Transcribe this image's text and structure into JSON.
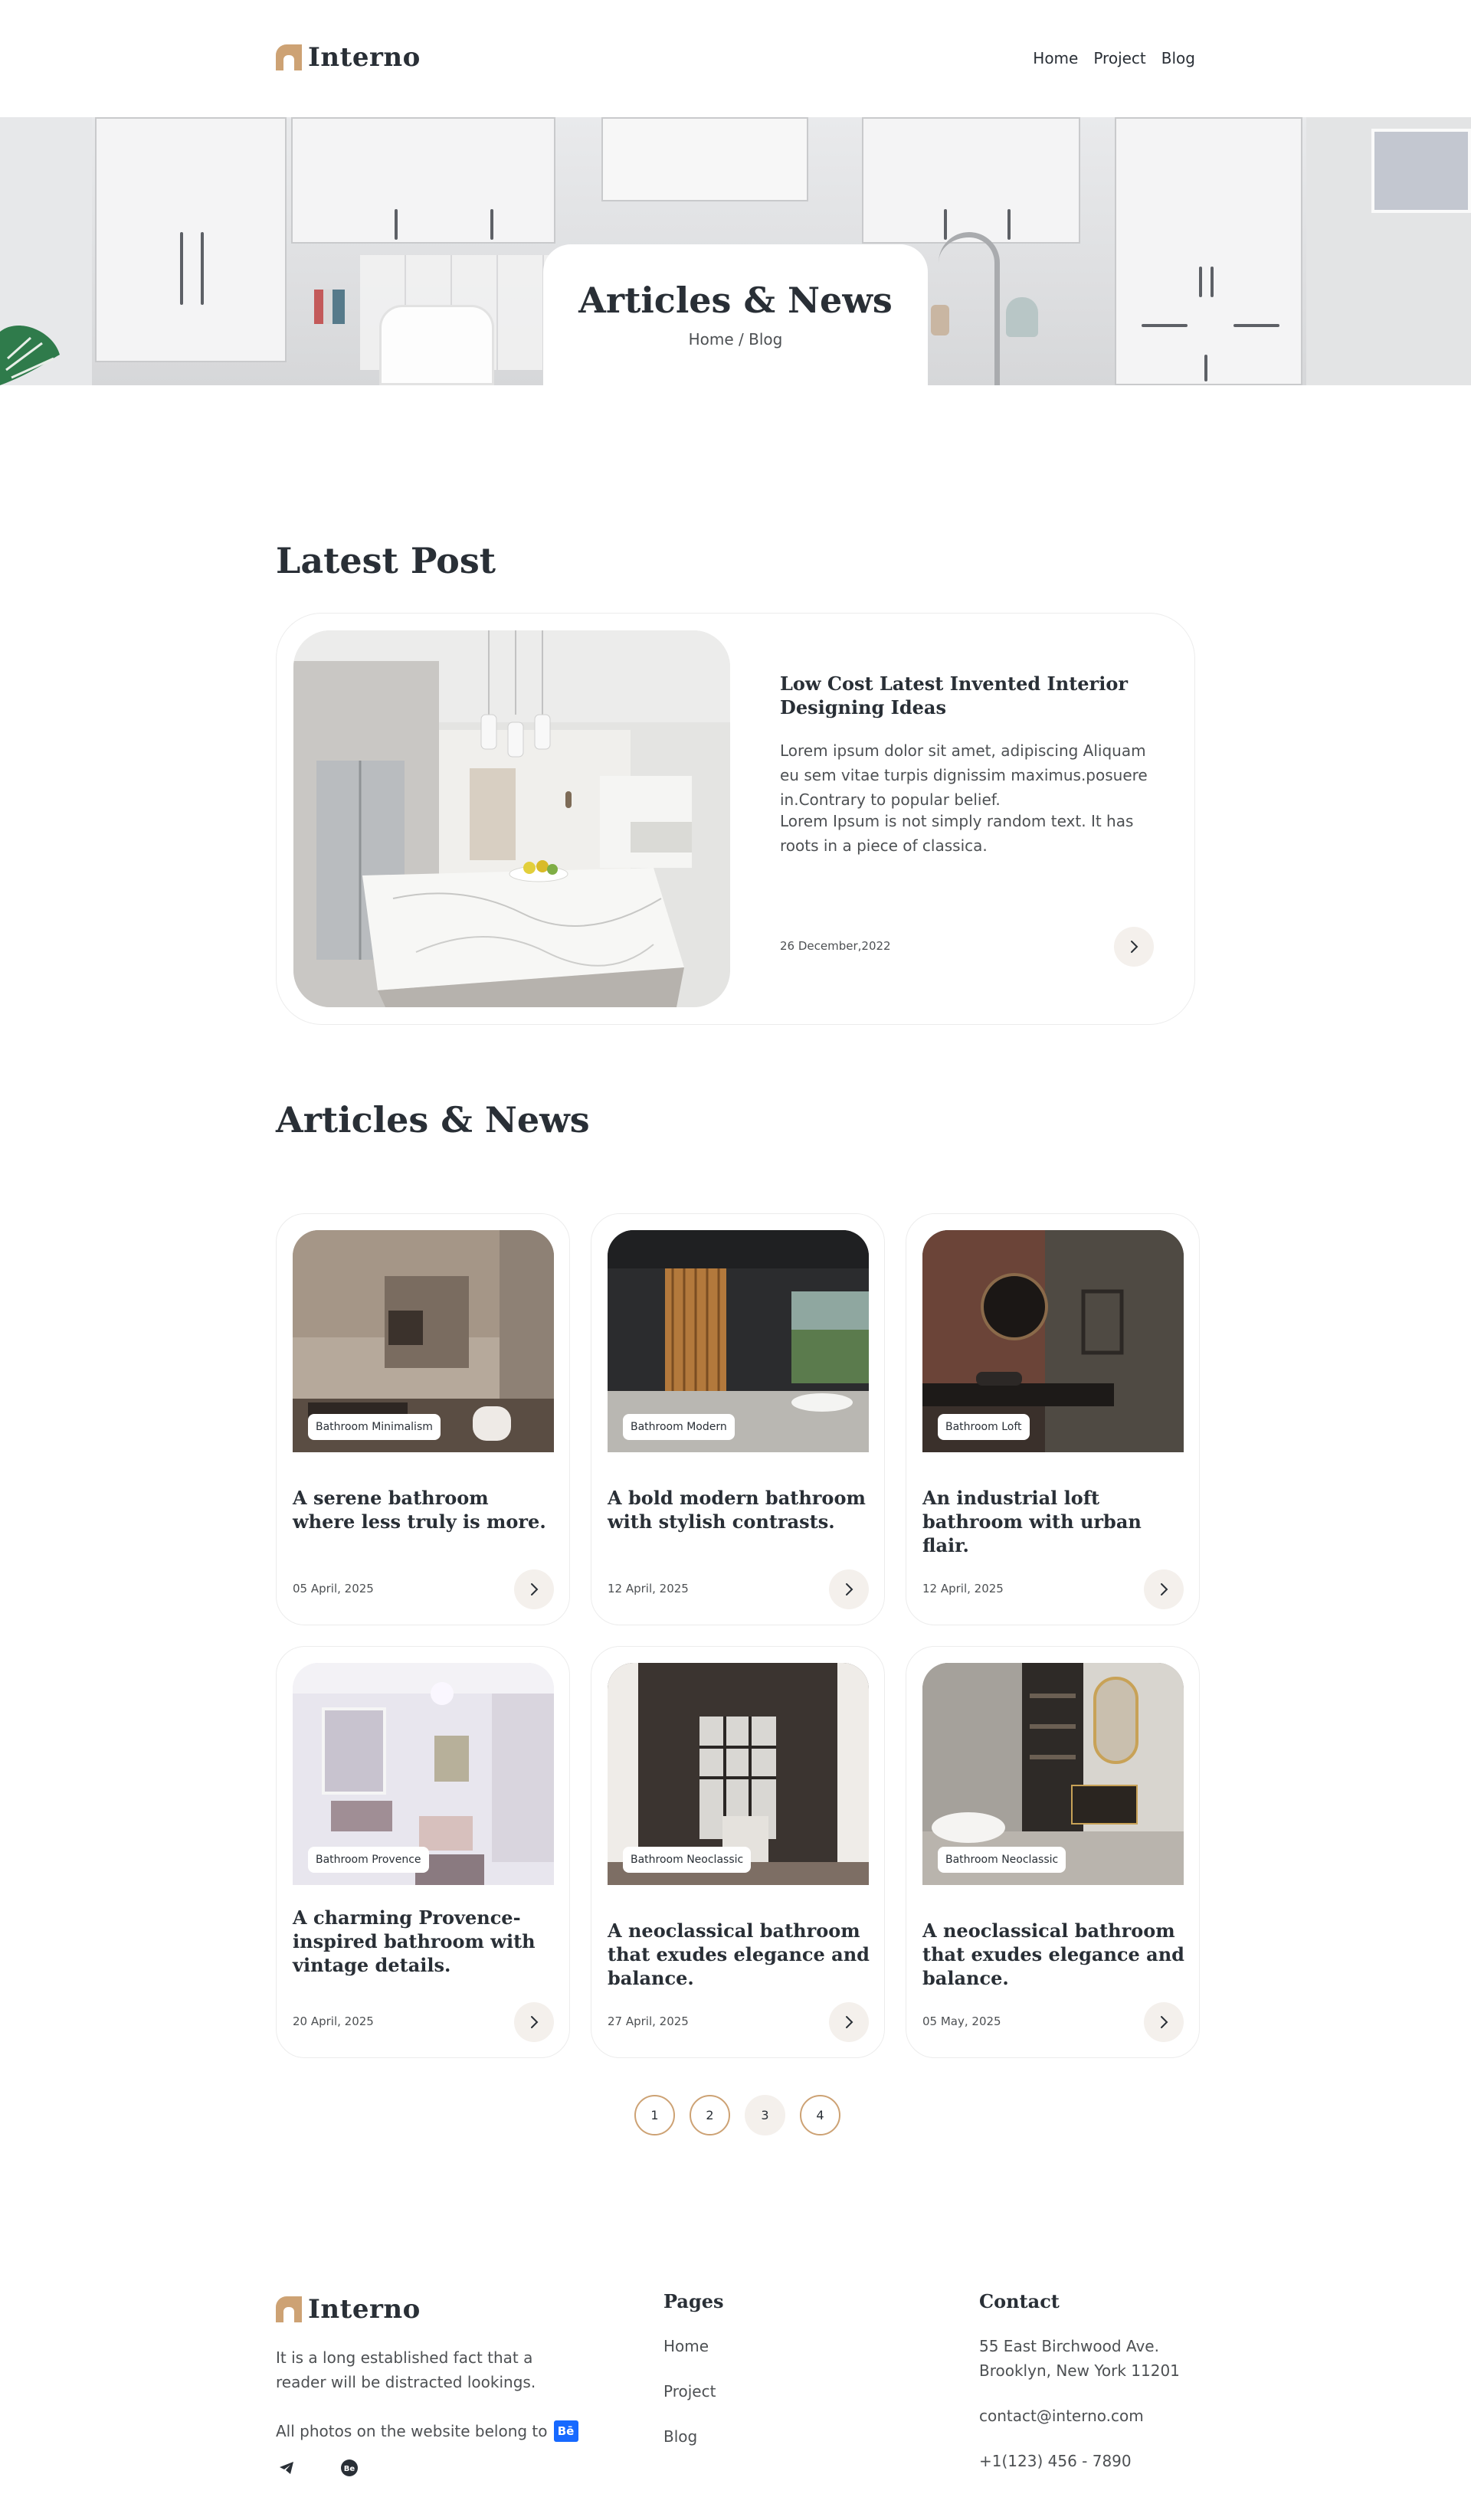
{
  "brand": {
    "name": "Interno",
    "accent": "#cda274",
    "dark": "#292f36",
    "muted": "#4d5053",
    "soft_bg": "#f4f0ec"
  },
  "nav": {
    "items": [
      "Home",
      "Project",
      "Blog"
    ]
  },
  "hero": {
    "title": "Articles & News",
    "breadcrumb": "Home / Blog"
  },
  "latest": {
    "section_title": "Latest Post",
    "title": "Low Cost Latest Invented Interior Designing Ideas",
    "paragraph1": "Lorem ipsum dolor sit amet, adipiscing Aliquam eu sem vitae turpis dignissim maximus.posuere in.Contrary to popular belief.",
    "paragraph2": "Lorem Ipsum is not simply random text. It has roots in a piece of classica.",
    "date": "26 December,2022",
    "arrow_icon": "chevron-right-icon"
  },
  "articles": {
    "section_title": "Articles & News",
    "items": [
      {
        "tag": "Bathroom Minimalism",
        "title": "A serene bathroom where less truly is more.",
        "date": "05 April, 2025"
      },
      {
        "tag": "Bathroom Modern",
        "title": "A bold modern bathroom with stylish contrasts.",
        "date": "12 April, 2025"
      },
      {
        "tag": "Bathroom Loft",
        "title": "An industrial loft bathroom with urban flair.",
        "date": "12 April, 2025"
      },
      {
        "tag": "Bathroom Provence",
        "title": "A charming Provence-inspired bathroom with vintage details.",
        "date": "20 April, 2025"
      },
      {
        "tag": "Bathroom Neoclassic",
        "title": "A neoclassical bathroom that exudes elegance and balance.",
        "date": "27 April, 2025"
      },
      {
        "tag": "Bathroom Neoclassic",
        "title": "A neoclassical bathroom that exudes elegance and balance.",
        "date": "05 May, 2025"
      }
    ]
  },
  "pagination": {
    "pages": [
      "1",
      "2",
      "3",
      "4"
    ],
    "current": "3"
  },
  "footer": {
    "description": "It is a long established fact that a reader will be distracted lookings.",
    "credit": "All photos on the website belong to",
    "credit_badge": "Bē",
    "pages_title": "Pages",
    "pages": [
      "Home",
      "Project",
      "Blog"
    ],
    "contact_title": "Contact",
    "address_line1": "55 East Birchwood Ave.",
    "address_line2": "Brooklyn, New York 11201",
    "email": "contact@interno.com",
    "phone": "+1(123) 456 - 7890",
    "social_icons": [
      "telegram-icon",
      "behance-icon"
    ]
  }
}
